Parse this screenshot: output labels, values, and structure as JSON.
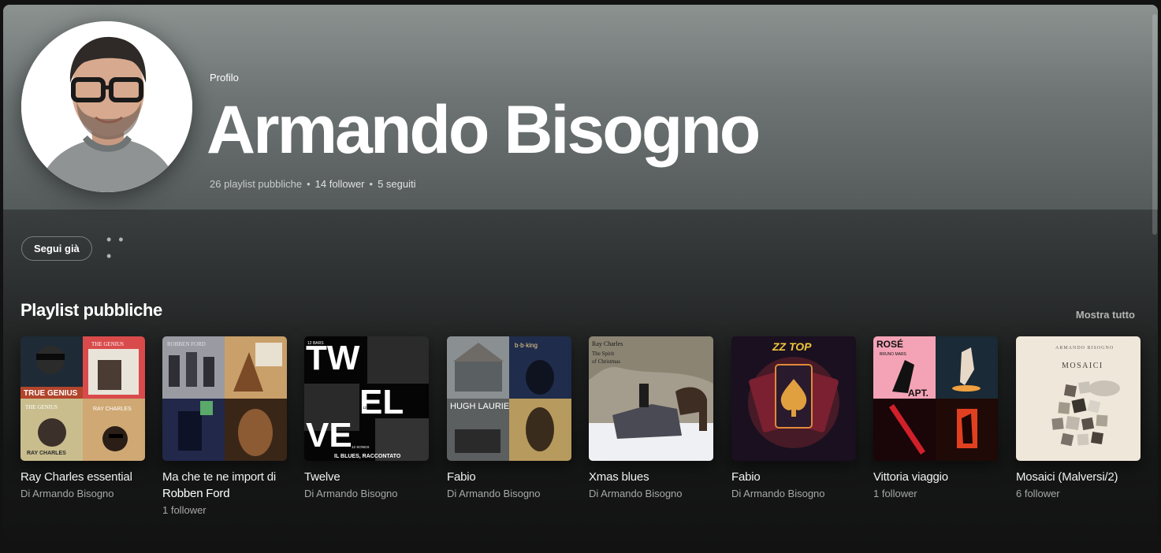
{
  "profile": {
    "kind": "Profilo",
    "name": "Armando Bisogno",
    "playlists": "26 playlist pubbliche",
    "followers": "14 follower",
    "following": "5 seguiti",
    "separator": "•"
  },
  "actions": {
    "follow_label": "Segui già",
    "more_label": "• • •"
  },
  "section": {
    "title": "Playlist pubbliche",
    "show_all": "Mostra tutto"
  },
  "playlists": [
    {
      "title": "Ray Charles essential",
      "subtitle": "Di Armando Bisogno",
      "followers": ""
    },
    {
      "title": "Ma che te ne import di Robben Ford",
      "subtitle": "1 follower",
      "followers": ""
    },
    {
      "title": "Twelve",
      "subtitle": "Di Armando Bisogno",
      "followers": ""
    },
    {
      "title": "Fabio",
      "subtitle": "Di Armando Bisogno",
      "followers": ""
    },
    {
      "title": "Xmas blues",
      "subtitle": "Di Armando Bisogno",
      "followers": ""
    },
    {
      "title": "Fabio",
      "subtitle": "Di Armando Bisogno",
      "followers": ""
    },
    {
      "title": "Vittoria viaggio",
      "subtitle": "1 follower",
      "followers": ""
    },
    {
      "title": "Mosaici (Malversi/2)",
      "subtitle": "6 follower",
      "followers": ""
    }
  ],
  "cover_text": {
    "c1_a": "TRUE GENIUS",
    "c1_b": "THE GENIUS",
    "c1_c": "RAY CHARLES",
    "c1_d": "RAY CHARLES",
    "c2_a": "ROBBEN FORD",
    "c3_a": "TW",
    "c3_b": "EL",
    "c3_c": "VE",
    "c3_d": "IL BLUES, RACCONTATO",
    "c3_e": "12 BARS",
    "c3_f": "12 STORIES",
    "c3_g": "12 SONGS",
    "c4_a": "HUGH LAURIE",
    "c4_b": "b·b·king",
    "c5_a": "Ray Charles",
    "c5_b": "The Spirit",
    "c5_c": "of Christmas",
    "c6_a": "ZZ TOP",
    "c7_a": "ROSÉ",
    "c7_b": "BRUNO MARS",
    "c7_c": "APT.",
    "c8_a": "ARMANDO BISOGNO",
    "c8_b": "MOSAICI"
  },
  "colors": {
    "hero_top": "#8b9290",
    "hero_bottom": "#555b5b",
    "background": "#121212",
    "subtle_text": "#a7a7a7"
  }
}
